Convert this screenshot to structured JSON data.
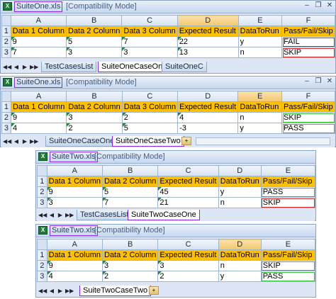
{
  "windows": [
    {
      "filename": "SuiteOne.xls",
      "mode": "[Compatibility Mode]",
      "columns": [
        "A",
        "B",
        "C",
        "D",
        "E",
        "F"
      ],
      "selected_column": "D",
      "rows": [
        {
          "num": "1",
          "cells": [
            "Data 1 Column",
            "Data 2 Column",
            "Data 3 Column",
            "Expected Result",
            "DataToRun",
            "Pass/Fail/Skip"
          ]
        },
        {
          "num": "2",
          "cells": [
            "9",
            "5",
            "7",
            "22",
            "y",
            "FAIL"
          ],
          "status": "fail"
        },
        {
          "num": "3",
          "cells": [
            "7",
            "3",
            "3",
            "13",
            "n",
            "SKIP"
          ],
          "status": "skip-red"
        }
      ],
      "tabs": [
        "TestCasesList",
        "SuiteOneCaseOne",
        "SuiteOneC"
      ],
      "active_tab": "SuiteOneCaseOne"
    },
    {
      "filename": "SuiteOne.xls",
      "mode": "[Compatibility Mode]",
      "columns": [
        "A",
        "B",
        "C",
        "D",
        "E",
        "F"
      ],
      "selected_column": "E",
      "rows": [
        {
          "num": "1",
          "cells": [
            "Data 1 Column",
            "Data 2 Column",
            "Data 3 Column",
            "Expected Result",
            "DataToRun",
            "Pass/Fail/Skip"
          ]
        },
        {
          "num": "2",
          "cells": [
            "9",
            "3",
            "2",
            "4",
            "n",
            "SKIP"
          ],
          "status": "skip-green"
        },
        {
          "num": "3",
          "cells": [
            "4",
            "2",
            "5",
            "-3",
            "y",
            "PASS"
          ],
          "status": "pass"
        }
      ],
      "tabs": [
        "SuiteOneCaseOne",
        "SuiteOneCaseTwo"
      ],
      "active_tab": "SuiteOneCaseTwo"
    },
    {
      "filename": "SuiteTwo.xls",
      "mode": "[Compatibility Mode]",
      "columns": [
        "A",
        "B",
        "C",
        "D",
        "E"
      ],
      "selected_column": "",
      "rows": [
        {
          "num": "1",
          "cells": [
            "Data 1 Column",
            "Data 2 Column",
            "Expected Result",
            "DataToRun",
            "Pass/Fail/Skip"
          ]
        },
        {
          "num": "2",
          "cells": [
            "9",
            "5",
            "45",
            "y",
            "PASS"
          ],
          "status": "pass"
        },
        {
          "num": "3",
          "cells": [
            "3",
            "7",
            "21",
            "n",
            "SKIP"
          ],
          "status": "skip-red"
        }
      ],
      "tabs": [
        "TestCasesList",
        "SuiteTwoCaseOne"
      ],
      "active_tab": "SuiteTwoCaseOne"
    },
    {
      "filename": "SuiteTwo.xls",
      "mode": "[Compatibility Mode]",
      "columns": [
        "A",
        "B",
        "C",
        "D",
        "E"
      ],
      "selected_column": "D",
      "rows": [
        {
          "num": "1",
          "cells": [
            "Data 1 Column",
            "Data 2 Column",
            "Expected Result",
            "DataToRun",
            "Pass/Fail/Skip"
          ]
        },
        {
          "num": "2",
          "cells": [
            "9",
            "3",
            "3",
            "n",
            "SKIP"
          ],
          "status": "skip-green"
        },
        {
          "num": "3",
          "cells": [
            "4",
            "2",
            "2",
            "y",
            "PASS"
          ],
          "status": "pass"
        }
      ],
      "tabs": [
        "SuiteTwoCaseTwo"
      ],
      "active_tab": "SuiteTwoCaseTwo"
    }
  ]
}
